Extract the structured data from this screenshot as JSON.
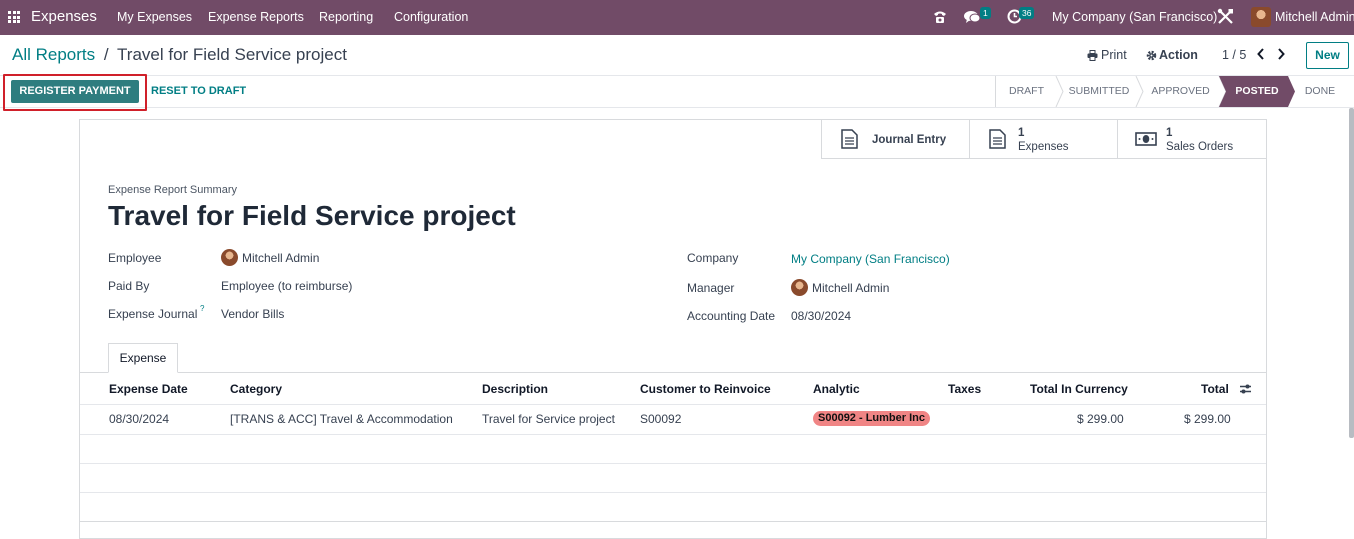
{
  "topbar": {
    "app_name": "Expenses",
    "menu": [
      "My Expenses",
      "Expense Reports",
      "Reporting",
      "Configuration"
    ],
    "messages_count": "1",
    "activities_count": "36",
    "company": "My Company (San Francisco)",
    "user": "Mitchell Admin"
  },
  "breadcrumb": {
    "parent": "All Reports",
    "separator": "/",
    "current": "Travel for Field Service project"
  },
  "controls": {
    "print": "Print",
    "action": "Action",
    "pager": "1 / 5",
    "new": "New"
  },
  "actions": {
    "register_payment": "REGISTER PAYMENT",
    "reset_to_draft": "RESET TO DRAFT"
  },
  "stages": [
    {
      "label": "DRAFT",
      "active": false
    },
    {
      "label": "SUBMITTED",
      "active": false
    },
    {
      "label": "APPROVED",
      "active": false
    },
    {
      "label": "POSTED",
      "active": true
    },
    {
      "label": "DONE",
      "active": false
    }
  ],
  "smart_buttons": {
    "journal_entry": "Journal Entry",
    "expenses_count": "1",
    "expenses": "Expenses",
    "sales_orders_count": "1",
    "sales_orders": "Sales Orders"
  },
  "form": {
    "summary_label": "Expense Report Summary",
    "title": "Travel for Field Service project",
    "employee_label": "Employee",
    "employee": "Mitchell Admin",
    "paid_by_label": "Paid By",
    "paid_by": "Employee (to reimburse)",
    "journal_label": "Expense Journal",
    "journal_help": "?",
    "journal": "Vendor Bills",
    "company_label": "Company",
    "company": "My Company (San Francisco)",
    "manager_label": "Manager",
    "manager": "Mitchell Admin",
    "accounting_date_label": "Accounting Date",
    "accounting_date": "08/30/2024"
  },
  "tab": "Expense",
  "table": {
    "headers": [
      "Expense Date",
      "Category",
      "Description",
      "Customer to Reinvoice",
      "Analytic",
      "Taxes",
      "Total In Currency",
      "Total"
    ],
    "rows": [
      {
        "date": "08/30/2024",
        "category": "[TRANS & ACC] Travel & Accommodation",
        "description": "Travel for Service project",
        "customer": "S00092",
        "analytic": "S00092 - Lumber Inc",
        "taxes": "",
        "total_currency": "$ 299.00",
        "total": "$ 299.00"
      }
    ]
  },
  "colors": {
    "brand": "#714b67",
    "accent": "#017e84",
    "posted": "#714b67",
    "analytic_tag": "#f08585",
    "highlight": "#d0202a"
  }
}
